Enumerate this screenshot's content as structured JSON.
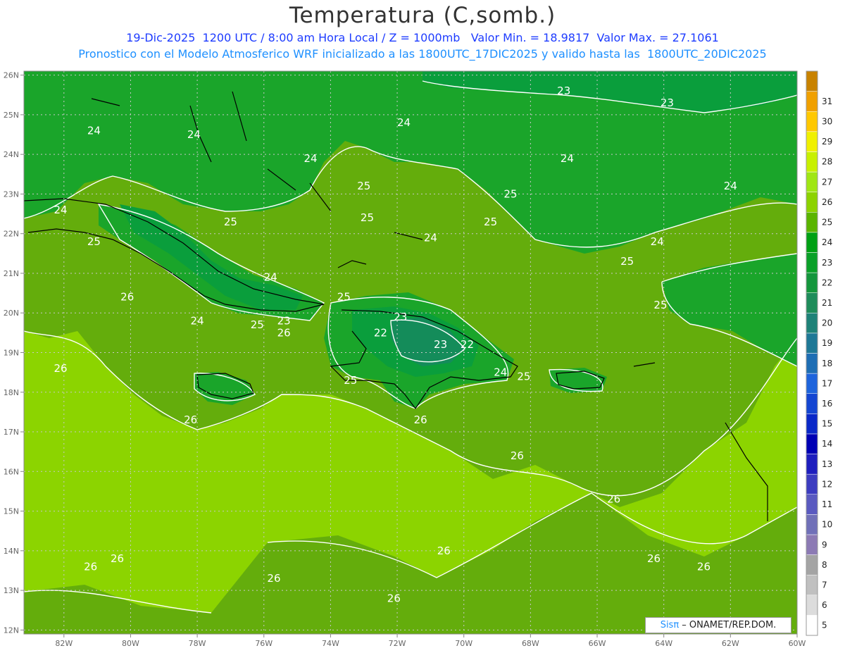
{
  "title": "Temperatura (C,somb.)",
  "subtitle_line1": "19-Dic-2025  1200 UTC / 8:00 am Hora Local / Z = 1000mb   Valor Min. = 18.9817  Valor Max. = 27.1061",
  "subtitle_line2": "Pronostico con el Modelo Atmosferico WRF inicializado a las 1800UTC_17DIC2025 y valido hasta las  1800UTC_20DIC2025",
  "credit": {
    "brand": "Sisπ",
    "text": " – ONAMET/REP.DOM."
  },
  "map": {
    "lon_min": -83.2,
    "lon_max": -60.0,
    "lat_min": 11.9,
    "lat_max": 26.1,
    "lon_ticks": [
      {
        "lon": -82,
        "label": "82W"
      },
      {
        "lon": -80,
        "label": "80W"
      },
      {
        "lon": -78,
        "label": "78W"
      },
      {
        "lon": -76,
        "label": "76W"
      },
      {
        "lon": -74,
        "label": "74W"
      },
      {
        "lon": -72,
        "label": "72W"
      },
      {
        "lon": -70,
        "label": "70W"
      },
      {
        "lon": -68,
        "label": "68W"
      },
      {
        "lon": -66,
        "label": "66W"
      },
      {
        "lon": -64,
        "label": "64W"
      },
      {
        "lon": -62,
        "label": "62W"
      },
      {
        "lon": -60,
        "label": "60W"
      }
    ],
    "lat_ticks": [
      {
        "lat": 26,
        "label": "26N"
      },
      {
        "lat": 25,
        "label": "25N"
      },
      {
        "lat": 24,
        "label": "24N"
      },
      {
        "lat": 23,
        "label": "23N"
      },
      {
        "lat": 22,
        "label": "22N"
      },
      {
        "lat": 21,
        "label": "21N"
      },
      {
        "lat": 20,
        "label": "20N"
      },
      {
        "lat": 19,
        "label": "19N"
      },
      {
        "lat": 18,
        "label": "18N"
      },
      {
        "lat": 17,
        "label": "17N"
      },
      {
        "lat": 16,
        "label": "16N"
      },
      {
        "lat": 15,
        "label": "15N"
      },
      {
        "lat": 14,
        "label": "14N"
      },
      {
        "lat": 13,
        "label": "13N"
      },
      {
        "lat": 12,
        "label": "12N"
      }
    ],
    "contour_labels": [
      {
        "lon": -81.1,
        "lat": 24.6,
        "text": "24"
      },
      {
        "lon": -78.1,
        "lat": 24.5,
        "text": "24"
      },
      {
        "lon": -71.8,
        "lat": 24.8,
        "text": "24"
      },
      {
        "lon": -74.6,
        "lat": 23.9,
        "text": "24"
      },
      {
        "lon": -66.9,
        "lat": 23.9,
        "text": "24"
      },
      {
        "lon": -62.0,
        "lat": 23.2,
        "text": "24"
      },
      {
        "lon": -82.1,
        "lat": 22.6,
        "text": "24"
      },
      {
        "lon": -71.0,
        "lat": 21.9,
        "text": "24"
      },
      {
        "lon": -64.2,
        "lat": 21.8,
        "text": "24"
      },
      {
        "lon": -75.8,
        "lat": 20.9,
        "text": "24"
      },
      {
        "lon": -78.0,
        "lat": 19.8,
        "text": "24"
      },
      {
        "lon": -68.9,
        "lat": 18.5,
        "text": "24"
      },
      {
        "lon": -67.0,
        "lat": 25.6,
        "text": "23"
      },
      {
        "lon": -63.9,
        "lat": 25.3,
        "text": "23"
      },
      {
        "lon": -71.9,
        "lat": 19.9,
        "text": "23"
      },
      {
        "lon": -75.4,
        "lat": 19.8,
        "text": "23"
      },
      {
        "lon": -70.7,
        "lat": 19.2,
        "text": "23"
      },
      {
        "lon": -72.5,
        "lat": 19.5,
        "text": "22"
      },
      {
        "lon": -69.9,
        "lat": 19.2,
        "text": "22"
      },
      {
        "lon": -73.0,
        "lat": 23.2,
        "text": "25"
      },
      {
        "lon": -72.9,
        "lat": 22.4,
        "text": "25"
      },
      {
        "lon": -68.6,
        "lat": 23.0,
        "text": "25"
      },
      {
        "lon": -69.2,
        "lat": 22.3,
        "text": "25"
      },
      {
        "lon": -77.0,
        "lat": 22.3,
        "text": "25"
      },
      {
        "lon": -81.1,
        "lat": 21.8,
        "text": "25"
      },
      {
        "lon": -73.6,
        "lat": 20.4,
        "text": "25"
      },
      {
        "lon": -76.2,
        "lat": 19.7,
        "text": "25"
      },
      {
        "lon": -73.4,
        "lat": 18.3,
        "text": "25"
      },
      {
        "lon": -68.2,
        "lat": 18.4,
        "text": "25"
      },
      {
        "lon": -65.1,
        "lat": 21.3,
        "text": "25"
      },
      {
        "lon": -64.1,
        "lat": 20.2,
        "text": "25"
      },
      {
        "lon": -80.1,
        "lat": 20.4,
        "text": "26"
      },
      {
        "lon": -75.4,
        "lat": 19.5,
        "text": "26"
      },
      {
        "lon": -82.1,
        "lat": 18.6,
        "text": "26"
      },
      {
        "lon": -78.2,
        "lat": 17.3,
        "text": "26"
      },
      {
        "lon": -71.3,
        "lat": 17.3,
        "text": "26"
      },
      {
        "lon": -68.4,
        "lat": 16.4,
        "text": "26"
      },
      {
        "lon": -65.5,
        "lat": 15.3,
        "text": "26"
      },
      {
        "lon": -70.6,
        "lat": 14.0,
        "text": "26"
      },
      {
        "lon": -64.3,
        "lat": 13.8,
        "text": "26"
      },
      {
        "lon": -62.8,
        "lat": 13.6,
        "text": "26"
      },
      {
        "lon": -80.4,
        "lat": 13.8,
        "text": "26"
      },
      {
        "lon": -81.2,
        "lat": 13.6,
        "text": "26"
      },
      {
        "lon": -75.7,
        "lat": 13.3,
        "text": "26"
      },
      {
        "lon": -72.1,
        "lat": 12.8,
        "text": "26"
      }
    ]
  },
  "colorbar": {
    "levels": [
      {
        "label": "5",
        "color": "#ffffff"
      },
      {
        "label": "6",
        "color": "#dcdcdc"
      },
      {
        "label": "7",
        "color": "#c0c0c0"
      },
      {
        "label": "8",
        "color": "#a4a4a4"
      },
      {
        "label": "9",
        "color": "#8c7ab4"
      },
      {
        "label": "10",
        "color": "#7070b8"
      },
      {
        "label": "11",
        "color": "#5a5ac0"
      },
      {
        "label": "12",
        "color": "#3c3cc0"
      },
      {
        "label": "13",
        "color": "#1e1ebe"
      },
      {
        "label": "14",
        "color": "#0000b4"
      },
      {
        "label": "15",
        "color": "#0a28c8"
      },
      {
        "label": "16",
        "color": "#1446d2"
      },
      {
        "label": "17",
        "color": "#1e64dc"
      },
      {
        "label": "18",
        "color": "#1e6eb4"
      },
      {
        "label": "19",
        "color": "#1e7896"
      },
      {
        "label": "20",
        "color": "#1e8278"
      },
      {
        "label": "21",
        "color": "#1e8c5a"
      },
      {
        "label": "22",
        "color": "#14963c"
      },
      {
        "label": "23",
        "color": "#0aa028"
      },
      {
        "label": "24",
        "color": "#00a014"
      },
      {
        "label": "25",
        "color": "#5ab400"
      },
      {
        "label": "26",
        "color": "#8cd200"
      },
      {
        "label": "27",
        "color": "#a0e614"
      },
      {
        "label": "28",
        "color": "#c8f000"
      },
      {
        "label": "29",
        "color": "#f0f000"
      },
      {
        "label": "30",
        "color": "#ffc800"
      },
      {
        "label": "31",
        "color": "#f0a000"
      },
      {
        "label": "",
        "color": "#c88200"
      }
    ]
  },
  "colors": {
    "t23": "#0a9e3c",
    "t24": "#1aa52a",
    "t25": "#64ad0c",
    "t26": "#8cd400",
    "t22": "#148c5a"
  }
}
